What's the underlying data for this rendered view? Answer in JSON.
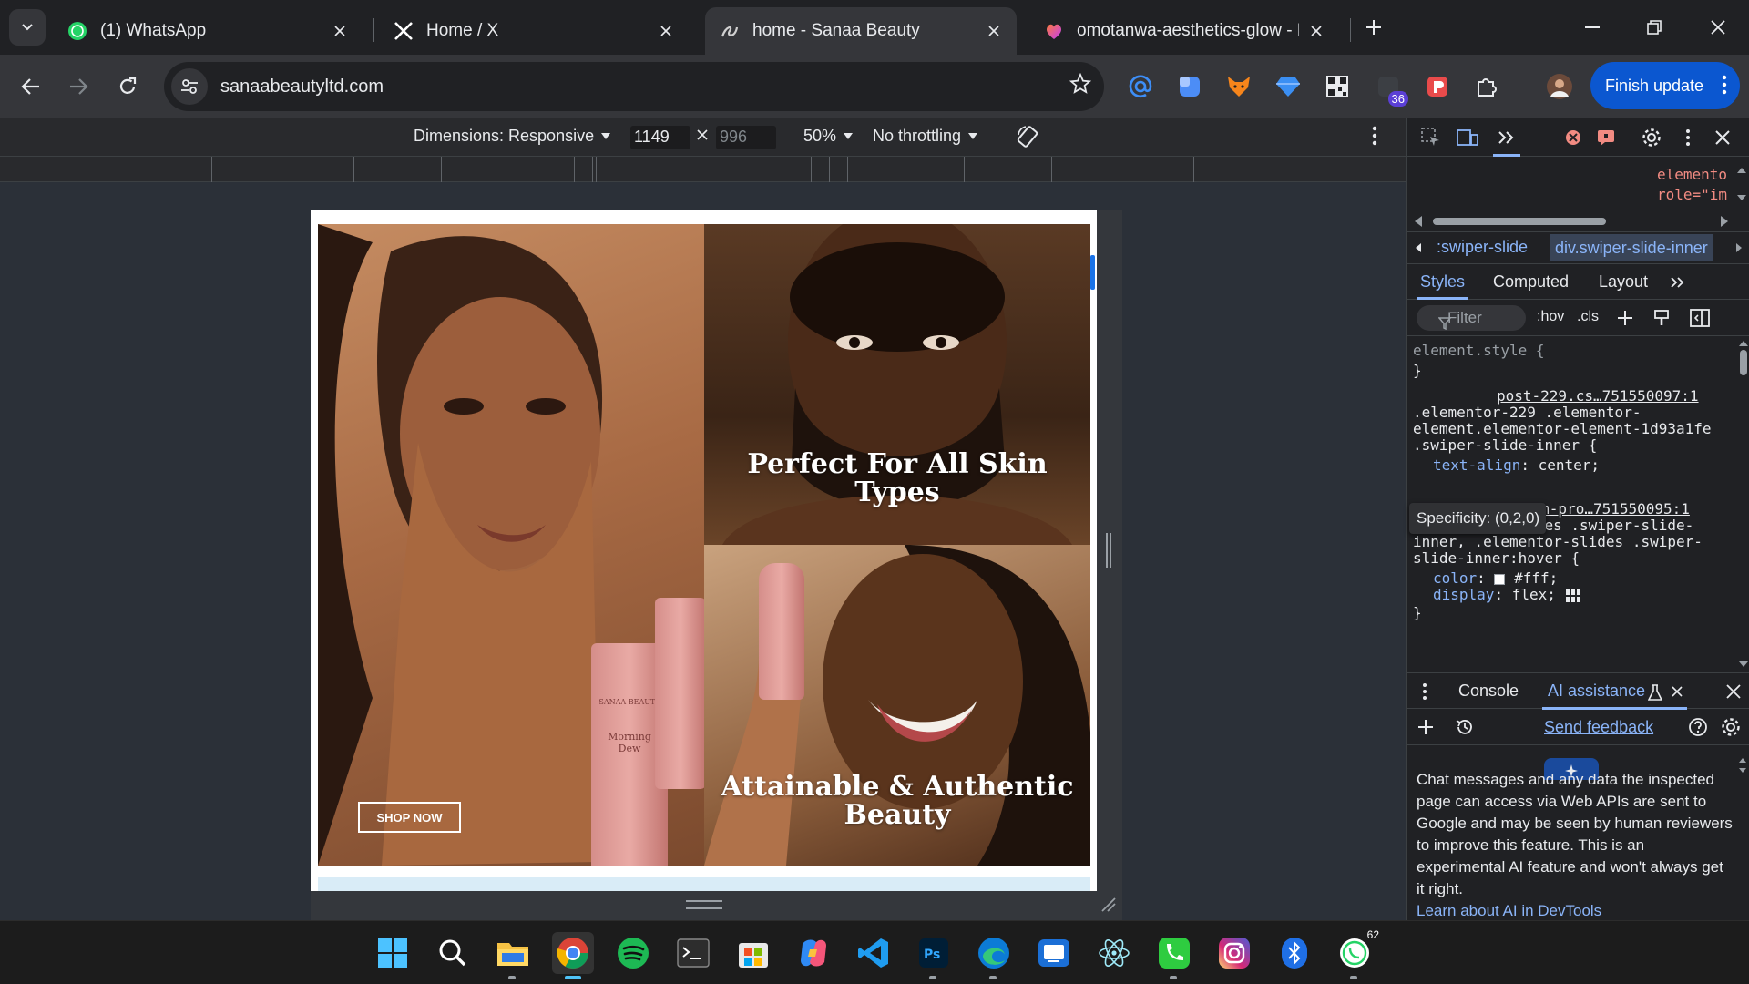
{
  "browser": {
    "tabs": [
      {
        "title": "(1) WhatsApp",
        "icon": "whatsapp-icon"
      },
      {
        "title": "Home / X",
        "icon": "x-logo-icon"
      },
      {
        "title": "home - Sanaa Beauty",
        "icon": "sanaa-logo-icon",
        "active": true
      },
      {
        "title": "omotanwa-aesthetics-glow - Lo",
        "icon": "lovable-icon"
      }
    ],
    "url": "sanaabeautyltd.com",
    "finish_update": "Finish update",
    "extensions": [
      "at-sign-icon",
      "blue-square-icon",
      "fox-icon",
      "diamond-icon",
      "qr-icon",
      "badge-counter-icon",
      "red-square-icon",
      "puzzle-icon",
      "profile-avatar"
    ],
    "extension_badge": "36"
  },
  "device_toolbar": {
    "dimensions_label": "Dimensions: Responsive",
    "width": "1149",
    "height": "996",
    "zoom": "50%",
    "throttling": "No throttling"
  },
  "page": {
    "slide_top_right_heading": "Perfect For All Skin Types",
    "slide_bottom_right_heading": "Attainable & Authentic Beauty",
    "shop_now": "SHOP NOW",
    "bottle_brand": "SANAA BEAUTY",
    "bottle_product": "Morning Dew"
  },
  "devtools": {
    "top_code_1": "elemento",
    "top_code_2": "role=\"im",
    "crumbs": [
      ":swiper-slide",
      "div.swiper-slide-inner"
    ],
    "subtabs": [
      "Styles",
      "Computed",
      "Layout"
    ],
    "filter_placeholder": "Filter",
    "hov": ":hov",
    "cls": ".cls",
    "styles": {
      "element_style": "element.style {",
      "close_brace": "}",
      "rule1_source": "post-229.cs…751550097:1",
      "rule1_sel1": ".elementor-229 .elementor-",
      "rule1_sel2": "element.elementor-element-1d93a1fe",
      "rule1_sel3": ".swiper-slide-inner {",
      "rule1_prop": "text-align",
      "rule1_val": "center;",
      "rule2_source": "custom-pro…751550095:1",
      "rule2_sel1": ".elementor-slides .swiper-slide-",
      "rule2_sel2": "inner, .elementor-slides .swiper-",
      "rule2_sel3": "slide-inner:hover {",
      "rule2_prop1": "color",
      "rule2_val1": "#fff;",
      "rule2_prop2": "display",
      "rule2_val2": "flex;"
    },
    "tooltip": "Specificity: (0,2,0)",
    "drawer_tabs": [
      "Console",
      "AI assistance"
    ],
    "send_feedback": "Send feedback",
    "ai_notice": "Chat messages and any data the inspected page can access via Web APIs are sent to Google and may be seen by human reviewers to improve this feature. This is an experimental AI feature and won't always get it right.",
    "ai_learn_link": "Learn about AI in DevTools"
  },
  "taskbar": {
    "apps": [
      "windows-start-icon",
      "search-icon",
      "file-explorer-icon",
      "chrome-icon",
      "spotify-icon",
      "terminal-icon",
      "microsoft-store-icon",
      "copilot-icon",
      "vscode-icon",
      "photoshop-icon",
      "edge-icon",
      "remote-desktop-icon",
      "electron-icon",
      "phone-link-icon",
      "instagram-icon",
      "bluetooth-icon",
      "whatsapp-icon"
    ],
    "whatsapp_badge": "62"
  },
  "colors": {
    "accent": "#0b57d0",
    "devtools_link": "#8ab4f8",
    "error_red": "#f28b82"
  }
}
